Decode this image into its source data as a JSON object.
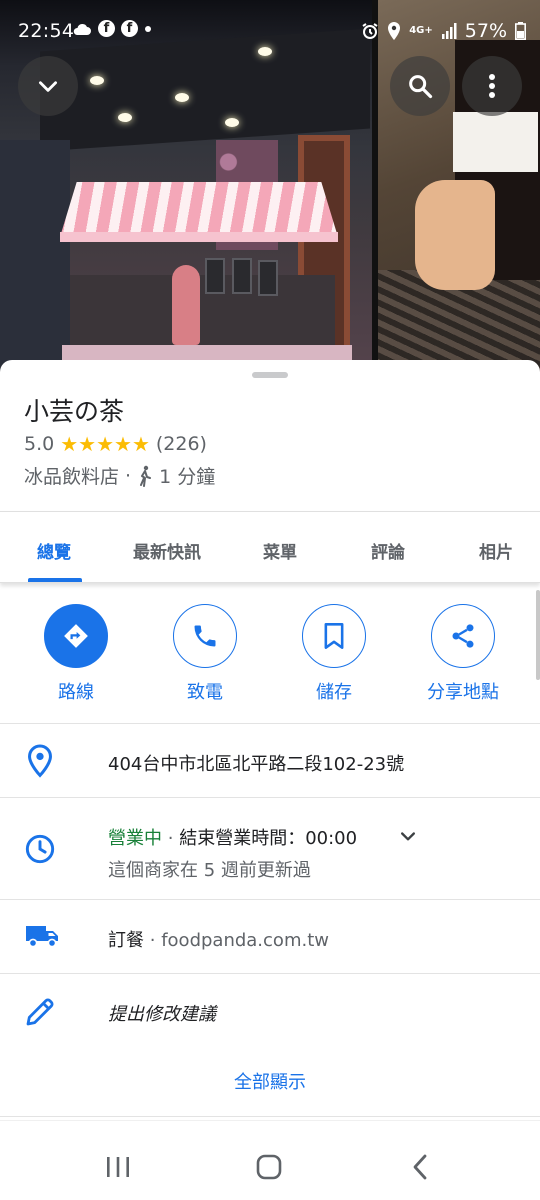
{
  "status_bar": {
    "time": "22:54",
    "network": "4G+",
    "battery": "57%",
    "icons": [
      "cloud-icon",
      "facebook-icon",
      "facebook-icon",
      "dot-icon",
      "alarm-icon",
      "location-icon",
      "signal-icon",
      "battery-icon"
    ]
  },
  "header_buttons": {
    "collapse": "chevron-down-icon",
    "search": "search-icon",
    "more": "more-vert-icon"
  },
  "place": {
    "name": "小芸の茶",
    "rating": "5.0",
    "stars": "★★★★★",
    "star_count": 5,
    "reviews": "(226)",
    "category": "冰品飲料店",
    "separator": "·",
    "walk_time": "1 分鐘"
  },
  "tabs": [
    {
      "label": "總覽",
      "active": true
    },
    {
      "label": "最新快訊",
      "active": false
    },
    {
      "label": "菜單",
      "active": false
    },
    {
      "label": "評論",
      "active": false
    },
    {
      "label": "相片",
      "active": false
    }
  ],
  "actions": [
    {
      "label": "路線",
      "icon": "directions-icon"
    },
    {
      "label": "致電",
      "icon": "phone-icon"
    },
    {
      "label": "儲存",
      "icon": "bookmark-icon"
    },
    {
      "label": "分享地點",
      "icon": "share-icon"
    }
  ],
  "info": {
    "address": "404台中市北區北平路二段102-23號",
    "hours_status": "營業中",
    "hours_sep": "·",
    "hours_close": "結束營業時間：00:00",
    "hours_updated": "這個商家在 5 週前更新過",
    "order_label": "訂餐",
    "order_sep": "·",
    "order_site": "foodpanda.com.tw",
    "suggest_edit": "提出修改建議",
    "show_all": "全部顯示"
  },
  "colors": {
    "accent": "#1a73e8",
    "open": "#188038",
    "star": "#fbbc04",
    "muted": "#5f6368"
  }
}
